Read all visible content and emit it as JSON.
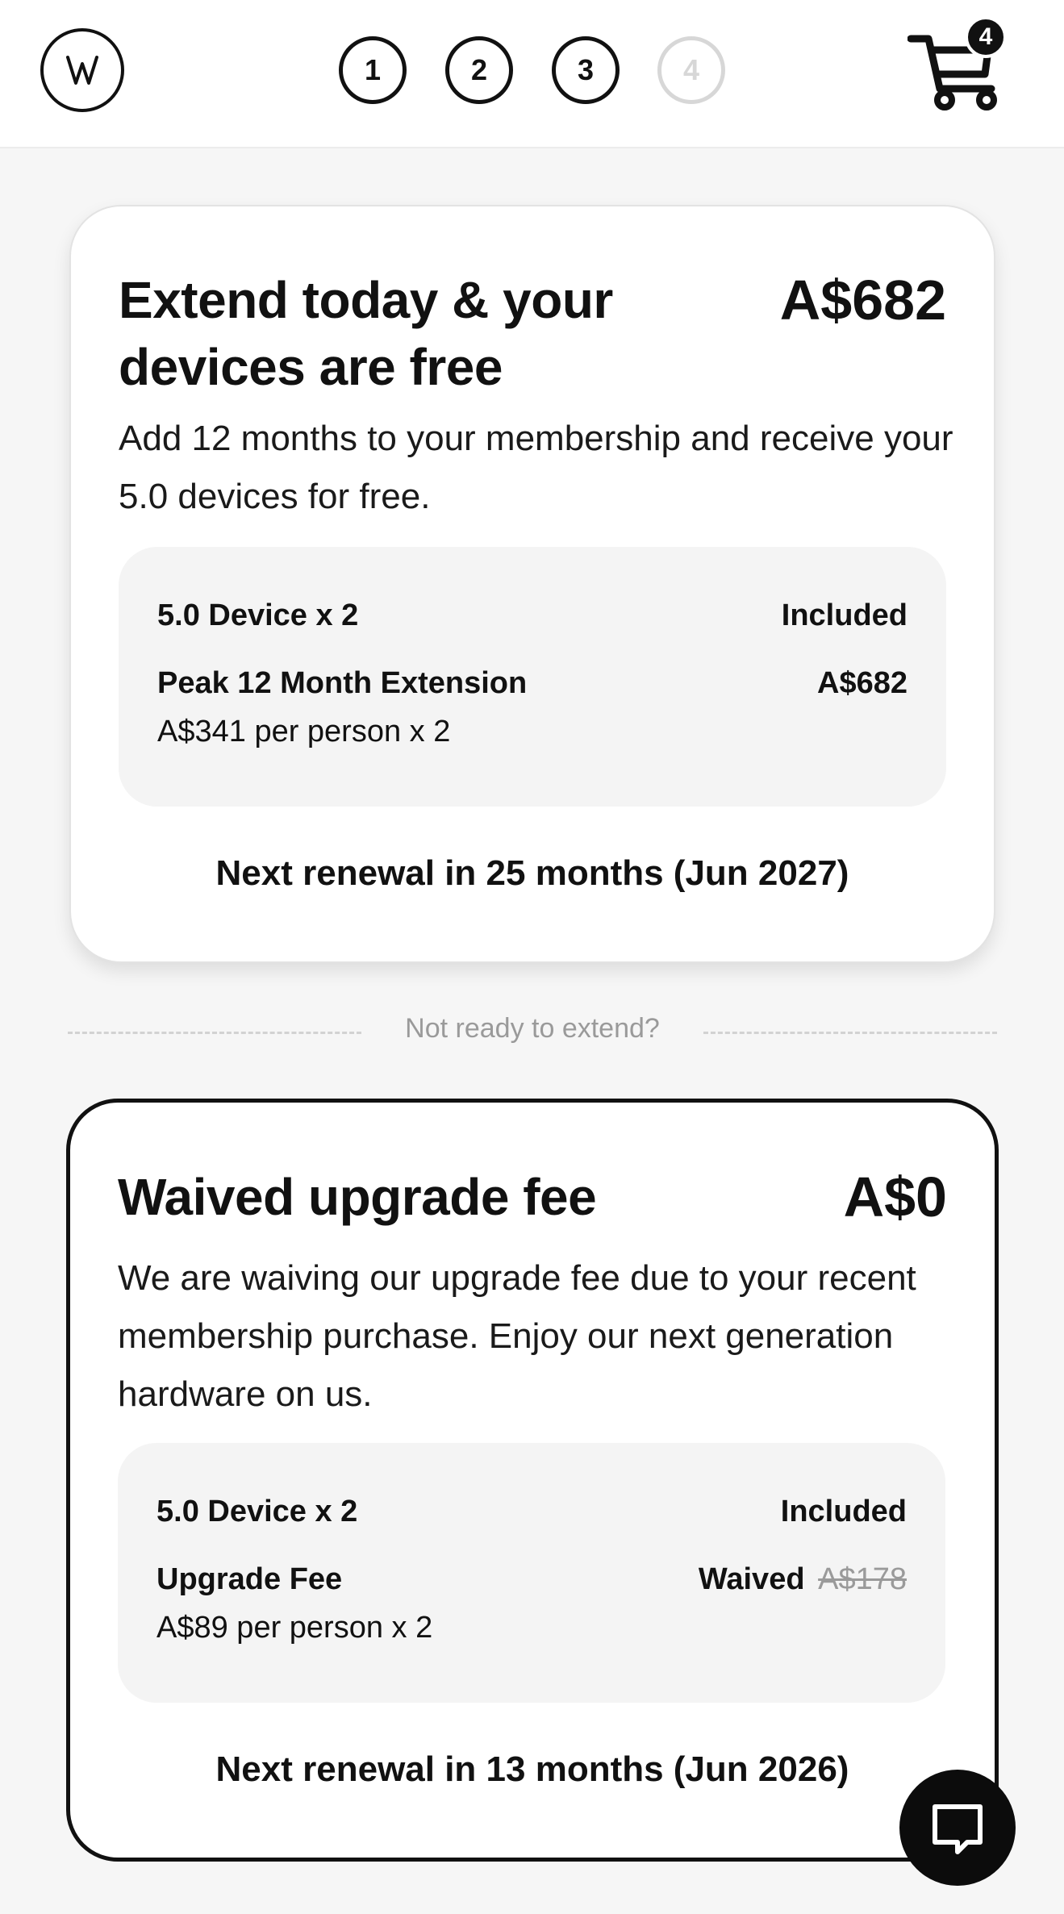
{
  "header": {
    "logo_icon": "wahoo-logo-icon",
    "steps": [
      {
        "label": "1",
        "active": true
      },
      {
        "label": "2",
        "active": true
      },
      {
        "label": "3",
        "active": true
      },
      {
        "label": "4",
        "active": false
      }
    ],
    "cart_icon": "shopping-cart-icon",
    "cart_count": "4"
  },
  "extend_card": {
    "title": "Extend today & your devices are free",
    "price": "A$682",
    "description": "Add 12 months to your membership and receive your 5.0 devices for free.",
    "rows": [
      {
        "label": "5.0 Device x 2",
        "value": "Included"
      },
      {
        "label": "Peak 12 Month Extension",
        "value": "A$682",
        "sub": "A$341 per person x 2"
      }
    ],
    "renewal": "Next renewal in 25 months (Jun 2027)"
  },
  "divider": {
    "text": "Not ready to extend?"
  },
  "waived_card": {
    "title": "Waived upgrade fee",
    "price": "A$0",
    "description": "We are waiving our upgrade fee due to your recent membership purchase. Enjoy our next generation hardware on us.",
    "rows": [
      {
        "label": "5.0 Device x 2",
        "value": "Included"
      },
      {
        "label": "Upgrade Fee",
        "value": "Waived",
        "strike": "A$178",
        "sub": "A$89 per person x 2"
      }
    ],
    "renewal": "Next renewal in 13 months (Jun 2026)"
  },
  "chat_button": {
    "icon": "chat-bubble-icon"
  },
  "colors": {
    "text": "#111111",
    "inactive_step": "#d7d7d7",
    "panel": "#f4f4f4",
    "muted": "#9a9a9a"
  }
}
